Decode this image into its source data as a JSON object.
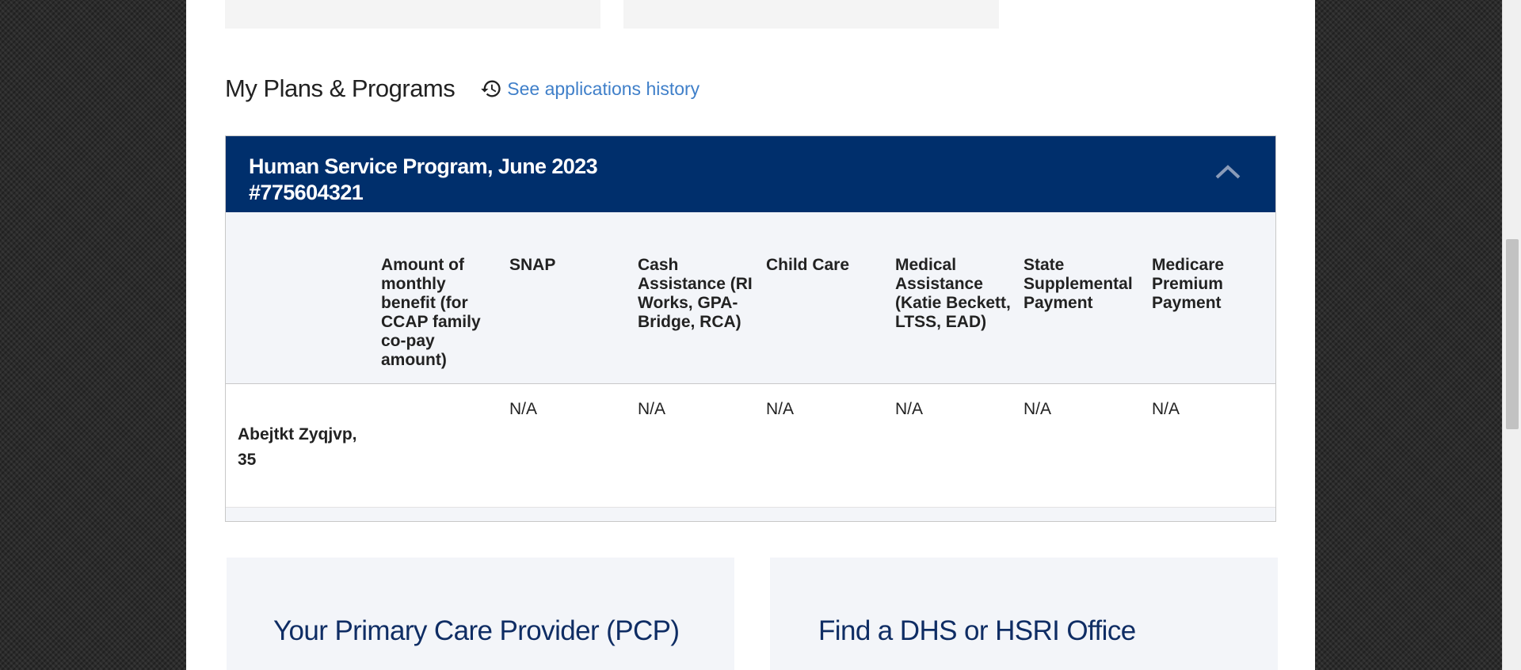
{
  "section": {
    "title": "My Plans & Programs",
    "history_link": "See applications history"
  },
  "program": {
    "title_line1": "Human Service Program, June 2023",
    "title_line2": "#775604321"
  },
  "table": {
    "headers": [
      "",
      "Amount of monthly benefit (for CCAP family co-pay amount)",
      "SNAP",
      "Cash Assistance (RI Works, GPA-Bridge, RCA)",
      "Child Care",
      "Medical Assistance (Katie Beckett, LTSS, EAD)",
      "State Supplemental Payment",
      "Medicare Premium Payment"
    ],
    "rows": [
      {
        "name": "Abejtkt Zyqjvp, 35",
        "values": [
          "",
          "N/A",
          "N/A",
          "N/A",
          "N/A",
          "N/A",
          "N/A"
        ]
      }
    ]
  },
  "cards": {
    "pcp_title": "Your Primary Care Provider (PCP)",
    "office_title": "Find a DHS or HSRI Office"
  },
  "icons": {
    "history": "history-icon",
    "collapse": "chevron-up-icon"
  },
  "colors": {
    "header_bg": "#002f6c",
    "link": "#3f7fc9",
    "card_title": "#0f2d64"
  }
}
